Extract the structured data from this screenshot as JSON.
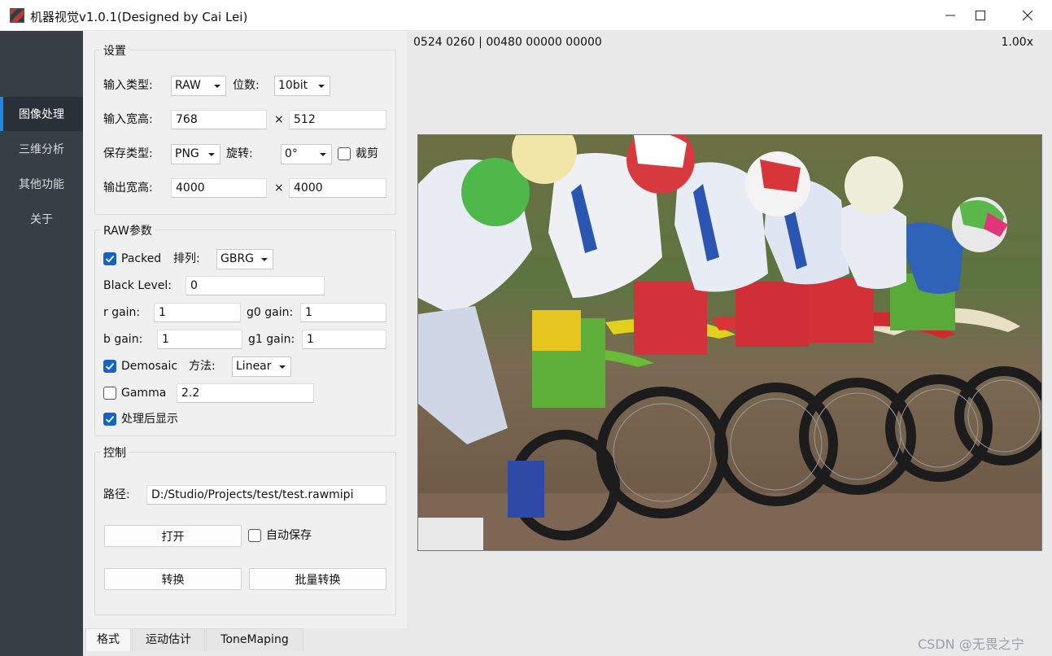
{
  "window": {
    "title": "机器视觉v1.0.1(Designed by Cai Lei)",
    "minimize_icon": "minimize-icon",
    "maximize_icon": "maximize-icon",
    "close_icon": "close-icon"
  },
  "sidebar": {
    "items": [
      {
        "label": "图像处理",
        "active": true
      },
      {
        "label": "三维分析",
        "active": false
      },
      {
        "label": "其他功能",
        "active": false
      },
      {
        "label": "关于",
        "active": false
      }
    ]
  },
  "settings": {
    "title": "设置",
    "input_type_label": "输入类型:",
    "input_type_value": "RAW",
    "bit_label": "位数:",
    "bit_value": "10bit",
    "input_size_label": "输入宽高:",
    "input_width": "768",
    "input_height": "512",
    "times": "×",
    "save_type_label": "保存类型:",
    "save_type_value": "PNG",
    "rotate_label": "旋转:",
    "rotate_value": "0°",
    "crop_label": "裁剪",
    "crop_checked": false,
    "output_size_label": "输出宽高:",
    "output_width": "4000",
    "output_height": "4000"
  },
  "raw": {
    "title": "RAW参数",
    "packed_label": "Packed",
    "packed_checked": true,
    "order_label": "排列:",
    "order_value": "GBRG",
    "black_level_label": "Black Level:",
    "black_level_value": "0",
    "r_gain_label": "r gain:",
    "r_gain_value": "1",
    "g0_gain_label": "g0 gain:",
    "g0_gain_value": "1",
    "b_gain_label": "b gain:",
    "b_gain_value": "1",
    "g1_gain_label": "g1 gain:",
    "g1_gain_value": "1",
    "demosaic_label": "Demosaic",
    "demosaic_checked": true,
    "method_label": "方法:",
    "method_value": "Linear",
    "gamma_label": "Gamma",
    "gamma_checked": false,
    "gamma_value": "2.2",
    "show_after_label": "处理后显示",
    "show_after_checked": true
  },
  "control": {
    "title": "控制",
    "path_label": "路径:",
    "path_value": "D:/Studio/Projects/test/test.rawmipi",
    "open_label": "打开",
    "auto_save_label": "自动保存",
    "auto_save_checked": false,
    "convert_label": "转换",
    "batch_convert_label": "批量转换"
  },
  "tabs": [
    {
      "label": "格式",
      "active": true
    },
    {
      "label": "运动估计",
      "active": false
    },
    {
      "label": "ToneMaping",
      "active": false
    }
  ],
  "viewer": {
    "pixel_info": "0524 0260 | 00480 00000 00000",
    "zoom": "1.00x",
    "image_description": "motocross riders at starting line"
  },
  "watermark": "CSDN @无畏之宁",
  "colors": {
    "sidebar_bg": "#373e45",
    "accent": "#1565c0",
    "active_indicator": "#1e88e5"
  }
}
